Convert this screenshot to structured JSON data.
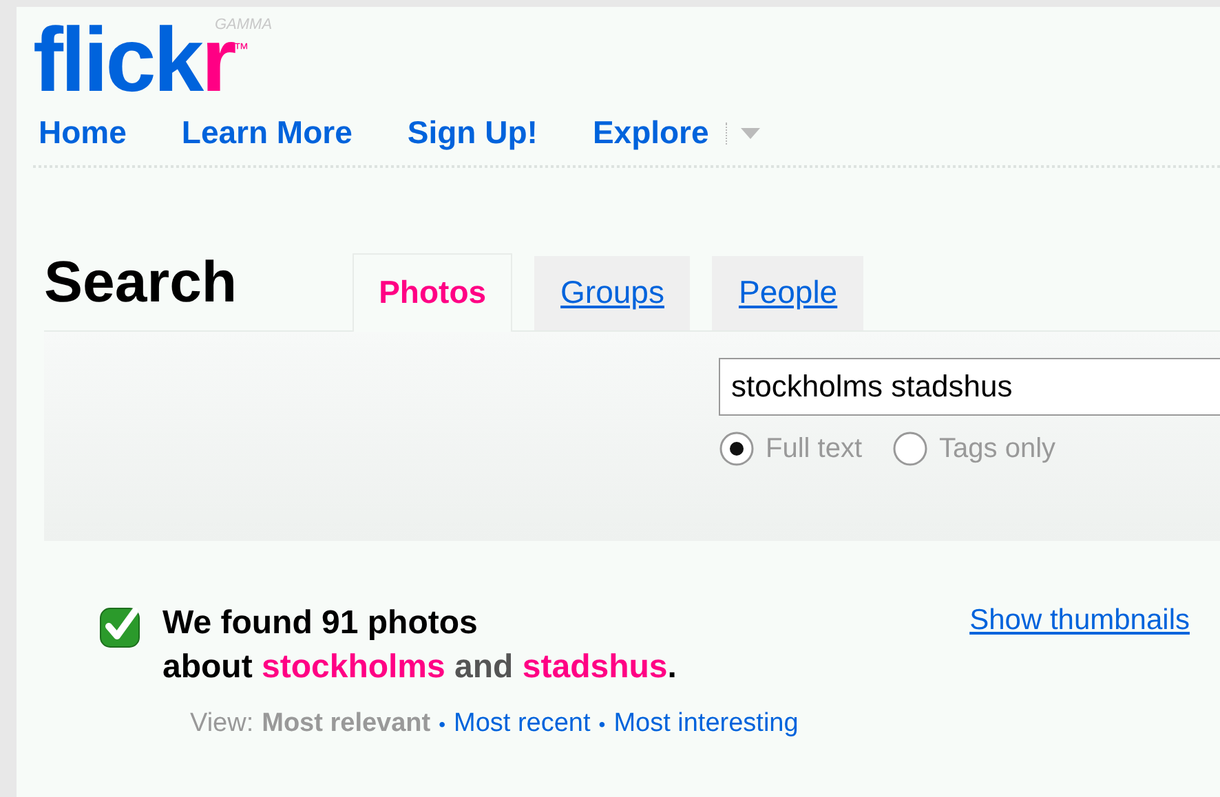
{
  "logo": {
    "main": "flick",
    "accent": "r",
    "badge": "GAMMA",
    "mark": "™"
  },
  "nav": [
    {
      "label": "Home"
    },
    {
      "label": "Learn More"
    },
    {
      "label": "Sign Up!"
    },
    {
      "label": "Explore",
      "menu": true
    }
  ],
  "search": {
    "title": "Search",
    "tabs": [
      {
        "label": "Photos",
        "selected": true
      },
      {
        "label": "Groups",
        "selected": false
      },
      {
        "label": "People",
        "selected": false
      }
    ],
    "query": "stockholms stadshus",
    "modes": [
      {
        "label": "Full text",
        "selected": true
      },
      {
        "label": "Tags only",
        "selected": false
      }
    ]
  },
  "result": {
    "headline": "We found 91 photos",
    "parts": [
      {
        "kind": "text",
        "text": "about "
      },
      {
        "kind": "term",
        "text": "stockholms"
      },
      {
        "kind": "joiner",
        "text": " and "
      },
      {
        "kind": "term",
        "text": "stadshus"
      },
      {
        "kind": "text",
        "text": "."
      }
    ],
    "show_thumbnails": "Show thumbnails",
    "view_label": "View:",
    "views": [
      {
        "label": "Most relevant",
        "selected": true
      },
      {
        "label": "Most recent",
        "selected": false
      },
      {
        "label": "Most interesting",
        "selected": false
      }
    ],
    "separator": "•"
  }
}
